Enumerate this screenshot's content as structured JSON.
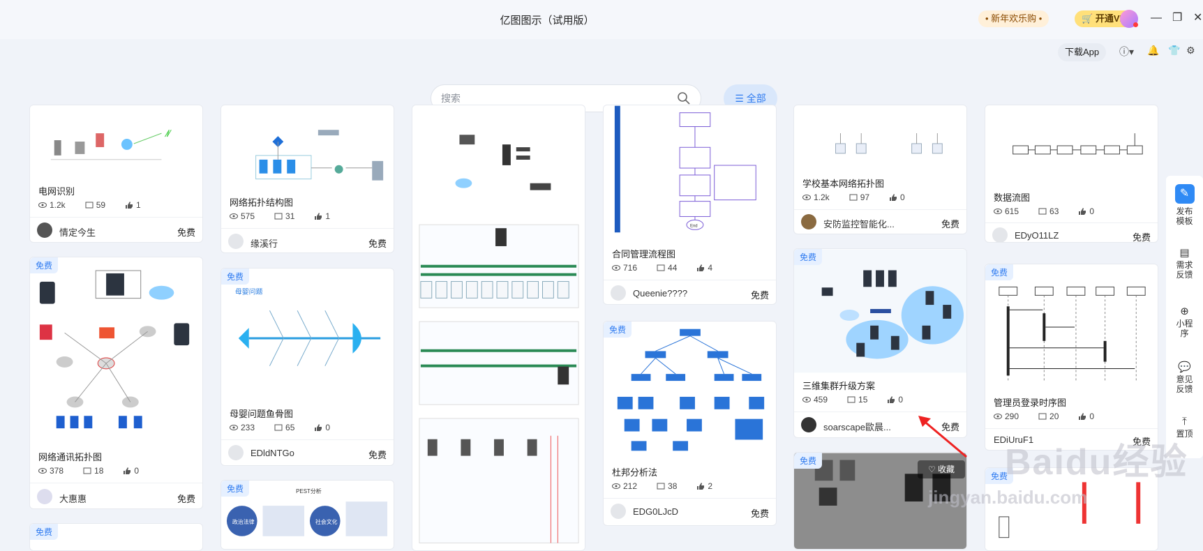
{
  "app": {
    "title": "亿图图示（试用版）"
  },
  "header": {
    "promo_label": "• 新年欢乐购 •",
    "vip_label": "开通VIP",
    "download_label": "下载App"
  },
  "search": {
    "placeholder": "搜索",
    "value": ""
  },
  "filter": {
    "all_label": "全部"
  },
  "common": {
    "free": "免费"
  },
  "cards": [
    {
      "title": "电网识别",
      "views": "1.2k",
      "comments": "59",
      "likes": "1",
      "author": "情定今生"
    },
    {
      "title": "网络拓扑结构图",
      "views": "575",
      "comments": "31",
      "likes": "1",
      "author": "缘溪行"
    },
    {
      "title": "合同管理流程图",
      "views": "716",
      "comments": "44",
      "likes": "4",
      "author": "Queenie????"
    },
    {
      "title": "学校基本网络拓扑图",
      "views": "1.2k",
      "comments": "97",
      "likes": "0",
      "author": "安防监控智能化..."
    },
    {
      "title": "数据流图",
      "views": "615",
      "comments": "63",
      "likes": "0",
      "author": "EDyO11LZ"
    },
    {
      "title": "网络通讯拓扑图",
      "views": "378",
      "comments": "18",
      "likes": "0",
      "author": "大惠惠"
    },
    {
      "title": "母婴问题鱼骨图",
      "views": "233",
      "comments": "65",
      "likes": "0",
      "author": "EDldNTGo"
    },
    {
      "title": "杜邦分析法",
      "views": "212",
      "comments": "38",
      "likes": "2",
      "author": "EDG0LJcD"
    },
    {
      "title": "三维集群升级方案",
      "views": "459",
      "comments": "15",
      "likes": "0",
      "author": "soarscape歐晨..."
    },
    {
      "title": "管理员登录时序图",
      "views": "290",
      "comments": "20",
      "likes": "0",
      "author": "EDiUruF1"
    }
  ],
  "thumb_text": {
    "fishbone": "母婴问题",
    "pest": "PEST分析",
    "pest_left": "政治法律",
    "pest_right": "社会文化",
    "mw_end": "End"
  },
  "overlay": {
    "collect_label": "收藏"
  },
  "sidebar": {
    "publish": "发布模板",
    "feedback_need": "需求反馈",
    "miniapp": "小程序",
    "feedback": "意见反馈",
    "top": "置顶"
  },
  "watermark": {
    "main": "Baidu经验",
    "sub": "jingyan.baidu.com"
  },
  "colors": {
    "accent": "#2f7bf0",
    "badge_bg": "#e6f0ff",
    "vip": "#ffe07a",
    "bg": "#f0f3f9"
  }
}
